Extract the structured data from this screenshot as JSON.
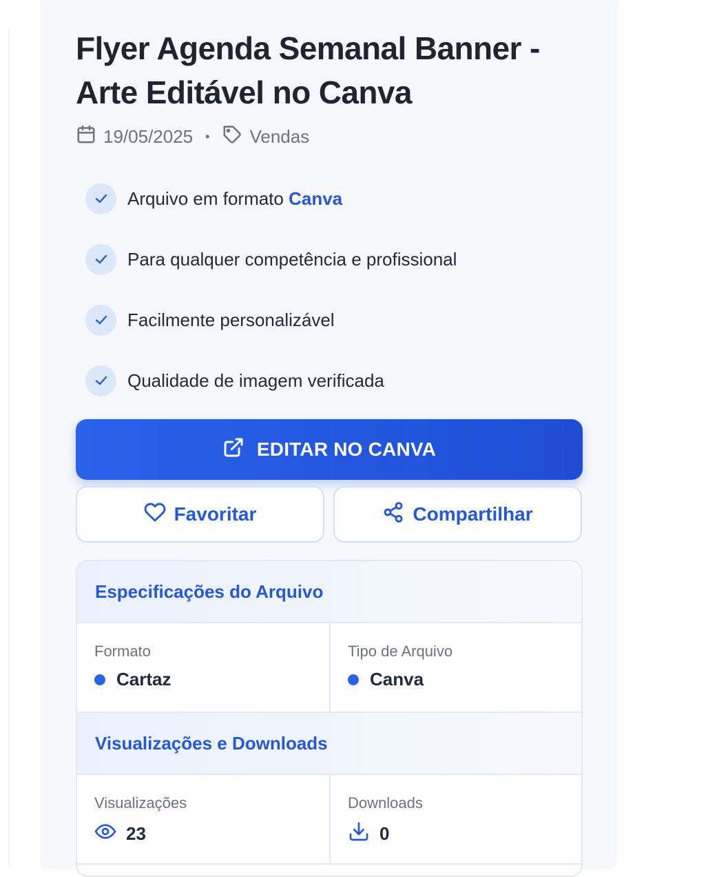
{
  "product": {
    "title": "Flyer Agenda Semanal Banner - Arte Editável no Canva",
    "date": "19/05/2025",
    "separator": "•",
    "category": "Vendas"
  },
  "features": [
    {
      "text_before": "Arquivo em formato ",
      "highlight": "Canva"
    },
    {
      "text_before": "Para qualquer competência e profissional",
      "highlight": ""
    },
    {
      "text_before": "Facilmente personalizável",
      "highlight": ""
    },
    {
      "text_before": "Qualidade de imagem verificada",
      "highlight": ""
    }
  ],
  "actions": {
    "edit_label": "EDITAR NO CANVA",
    "favorite_label": "Favoritar",
    "share_label": "Compartilhar"
  },
  "specs": {
    "title": "Especificações do Arquivo",
    "format_label": "Formato",
    "format_value": "Cartaz",
    "file_type_label": "Tipo de Arquivo",
    "file_type_value": "Canva",
    "stats_title": "Visualizações e Downloads",
    "views_label": "Visualizações",
    "views_value": "23",
    "downloads_label": "Downloads",
    "downloads_value": "0"
  },
  "icons": {
    "calendar": "calendar-icon",
    "tag": "tag-icon",
    "check": "check-icon",
    "external": "external-link-icon",
    "heart": "heart-icon",
    "share": "share-icon",
    "eye": "eye-icon",
    "download": "download-icon"
  },
  "colors": {
    "accent": "#2557d6",
    "title": "#1e2430",
    "muted": "#6b7280",
    "check_bg": "#dbe7fb"
  }
}
